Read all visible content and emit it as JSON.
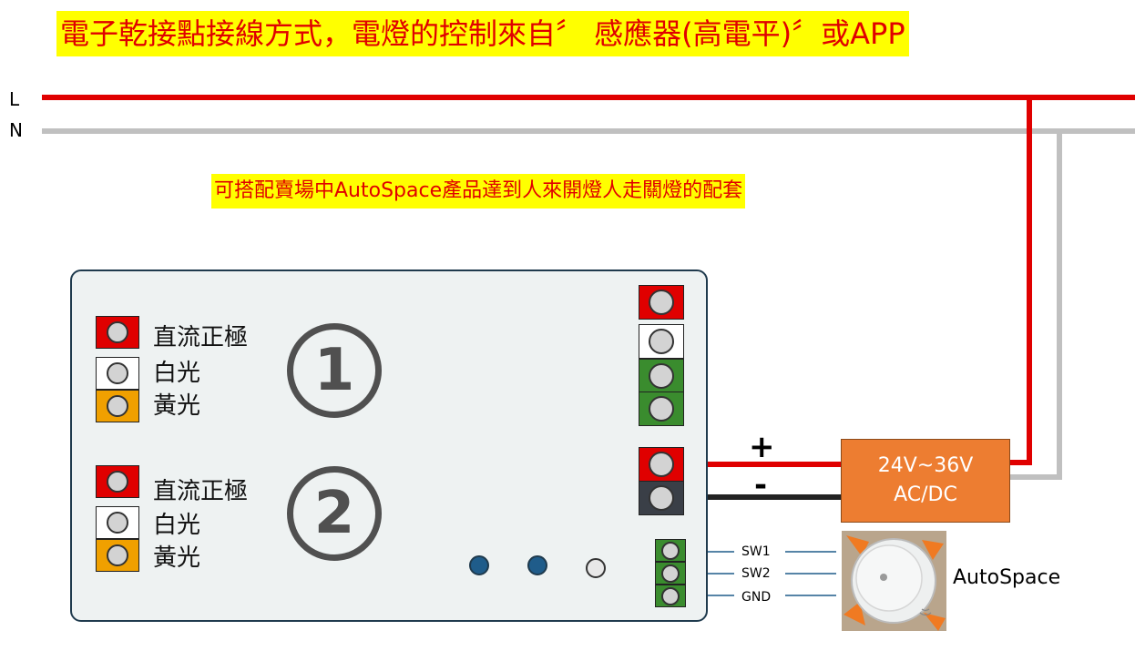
{
  "title": "電子乾接點接線方式，電燈的控制來自〞 感應器(高電平)〞或APP",
  "subtitle": "可搭配賣場中AutoSpace產品達到人來開燈人走關燈的配套",
  "lines": {
    "live": "L",
    "neutral": "N"
  },
  "colors": {
    "live_wire": "#e00000",
    "neutral_wire": "#c0c0c0",
    "negative_wire": "#222222",
    "signal_wire": "#1f5c8a",
    "psu": "#ed7d31",
    "terminal_red": "#e00000",
    "terminal_white": "#ffffff",
    "terminal_orange": "#f0a000",
    "terminal_green": "#3a8c2e",
    "terminal_dark": "#3a3f47",
    "highlight": "#ffff00"
  },
  "channels": [
    {
      "number": "1",
      "terminals": [
        {
          "label": "直流正極",
          "color": "red"
        },
        {
          "label": "白光",
          "color": "white"
        },
        {
          "label": "黃光",
          "color": "orange"
        }
      ]
    },
    {
      "number": "2",
      "terminals": [
        {
          "label": "直流正極",
          "color": "red"
        },
        {
          "label": "白光",
          "color": "white"
        },
        {
          "label": "黃光",
          "color": "orange"
        }
      ]
    }
  ],
  "power_supply": {
    "line1": "24V~36V",
    "line2": "AC/DC"
  },
  "polarity": {
    "positive": "+",
    "negative": "-"
  },
  "signals": [
    "SW1",
    "SW2",
    "GND"
  ],
  "sensor": {
    "label": "AutoSpace"
  },
  "icons": [
    "screw-terminal-icon",
    "circled-number-icon",
    "led-indicator-icon",
    "motion-sensor-icon"
  ]
}
